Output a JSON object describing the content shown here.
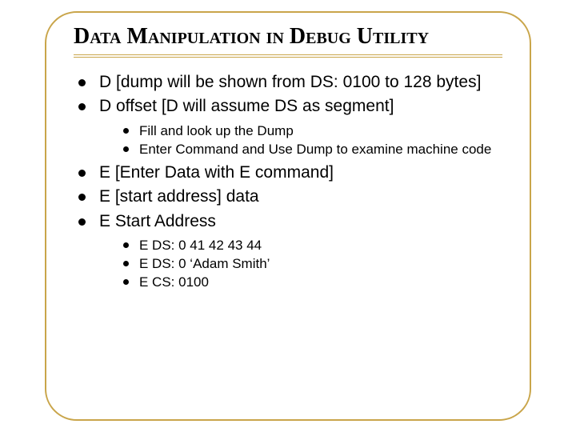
{
  "title": "Data Manipulation in Debug Utility",
  "bullets": {
    "b0": "D [dump will be shown from DS: 0100 to 128 bytes]",
    "b1": "D offset  [D will assume DS as segment]",
    "b2": "E [Enter Data with E command]",
    "b3": "E [start address] data",
    "b4": "E Start Address"
  },
  "sub1": {
    "s0": "Fill and look up the Dump",
    "s1": "Enter Command and Use Dump to examine machine code"
  },
  "sub2": {
    "s0": "E DS: 0 41 42 43 44",
    "s1": "E DS: 0 ‘Adam Smith’",
    "s2": "E CS: 0100"
  }
}
